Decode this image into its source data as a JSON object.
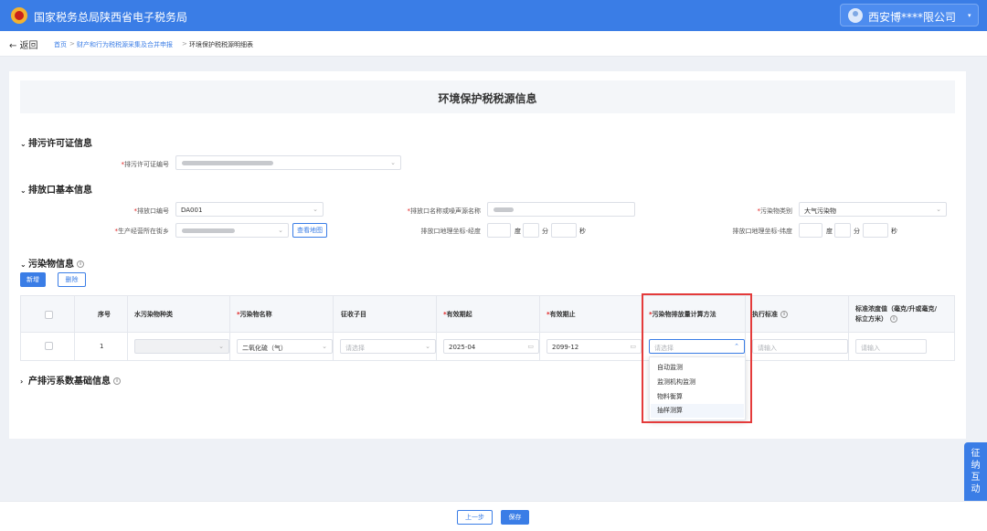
{
  "header": {
    "title": "国家税务总局陕西省电子税务局",
    "user": "西安博****限公司",
    "user_caret": "▾"
  },
  "breadcrumb": {
    "back": "← 返回",
    "items": [
      "首页",
      "财产和行为税税源采集及合并申报",
      "环境保护税税源明细表"
    ],
    "sep": ">"
  },
  "page_title": "环境保护税税源信息",
  "permit": {
    "section_title": "排污许可证信息",
    "permit_no_label": "排污许可证编号"
  },
  "outlet": {
    "section_title": "排放口基本信息",
    "outlet_no_label": "排放口编号",
    "outlet_no_value": "DA001",
    "outlet_name_label": "排放口名称或噪声源名称",
    "pollutant_type_label": "污染物类别",
    "pollutant_type_value": "大气污染物",
    "street_label": "生产经营所在街乡",
    "view_map": "查看地图",
    "longitude_label": "排放口地理坐标-经度",
    "latitude_label": "排放口地理坐标-纬度",
    "deg": "度",
    "min": "分",
    "sec": "秒"
  },
  "pollutants": {
    "section_title": "污染物信息",
    "add_btn": "新增",
    "delete_btn": "删除",
    "columns": {
      "seq": "序号",
      "water_type": "水污染物种类",
      "name": "污染物名称",
      "sub_item": "征收子目",
      "valid_from": "有效期起",
      "valid_to": "有效期止",
      "calc_method": "污染物排放量计算方法",
      "standard": "执行标准",
      "conc_line1": "标准浓度值（毫克/升或毫克/",
      "conc_line2": "标立方米）"
    },
    "row": {
      "seq": "1",
      "name": "二氧化硫（气）",
      "sub_item": "请选择",
      "valid_from": "2025-04",
      "valid_to": "2099-12",
      "calc_method": "请选择",
      "standard": "请输入",
      "concentration": "请输入"
    },
    "calc_options": [
      "自动监测",
      "监测机构监测",
      "物料衡算",
      "抽样测算"
    ]
  },
  "coefficient": {
    "section_title": "产排污系数基础信息"
  },
  "footer": {
    "prev": "上一步",
    "save": "保存"
  },
  "side_widget": [
    "征",
    "纳",
    "互",
    "动"
  ],
  "colors": {
    "brand_blue": "#3a7de6",
    "highlight_red": "#e43b3b",
    "required_red": "#e02020"
  }
}
